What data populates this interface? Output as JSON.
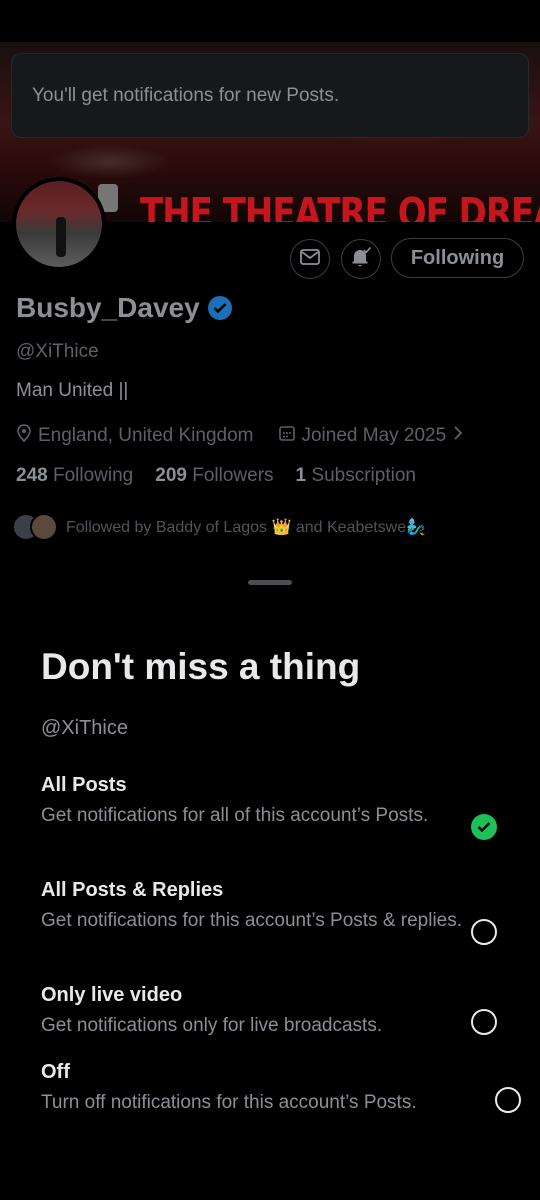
{
  "toast": {
    "message": "You'll get notifications for new Posts."
  },
  "banner": {
    "text": "THE THEATRE OF DREAMS"
  },
  "profile": {
    "display_name": "Busby_Davey",
    "handle": "@XiThice",
    "bio": "Man United ||",
    "location": "England, United Kingdom",
    "joined": "Joined May 2025",
    "following_count": "248",
    "following_label": "Following",
    "followers_count": "209",
    "followers_label": "Followers",
    "subscription_count": "1",
    "subscription_label": "Subscription",
    "followed_by": "Followed by Baddy of Lagos 👑 and Keabetswe🧞‍♂️",
    "follow_button_label": "Following"
  },
  "sheet": {
    "title": "Don't miss a thing",
    "handle": "@XiThice",
    "options": [
      {
        "title": "All Posts",
        "description": "Get notifications for all of this account’s Posts.",
        "selected": true
      },
      {
        "title": "All Posts & Replies",
        "description": "Get notifications for this account’s Posts & replies.",
        "selected": false
      },
      {
        "title": "Only live video",
        "description": "Get notifications only for live broadcasts.",
        "selected": false
      },
      {
        "title": "Off",
        "description": "Turn off notifications for this account’s Posts.",
        "selected": false
      }
    ]
  },
  "colors": {
    "accent_check": "#1fbf5a",
    "verified": "#1d6fb8",
    "background": "#000000"
  }
}
